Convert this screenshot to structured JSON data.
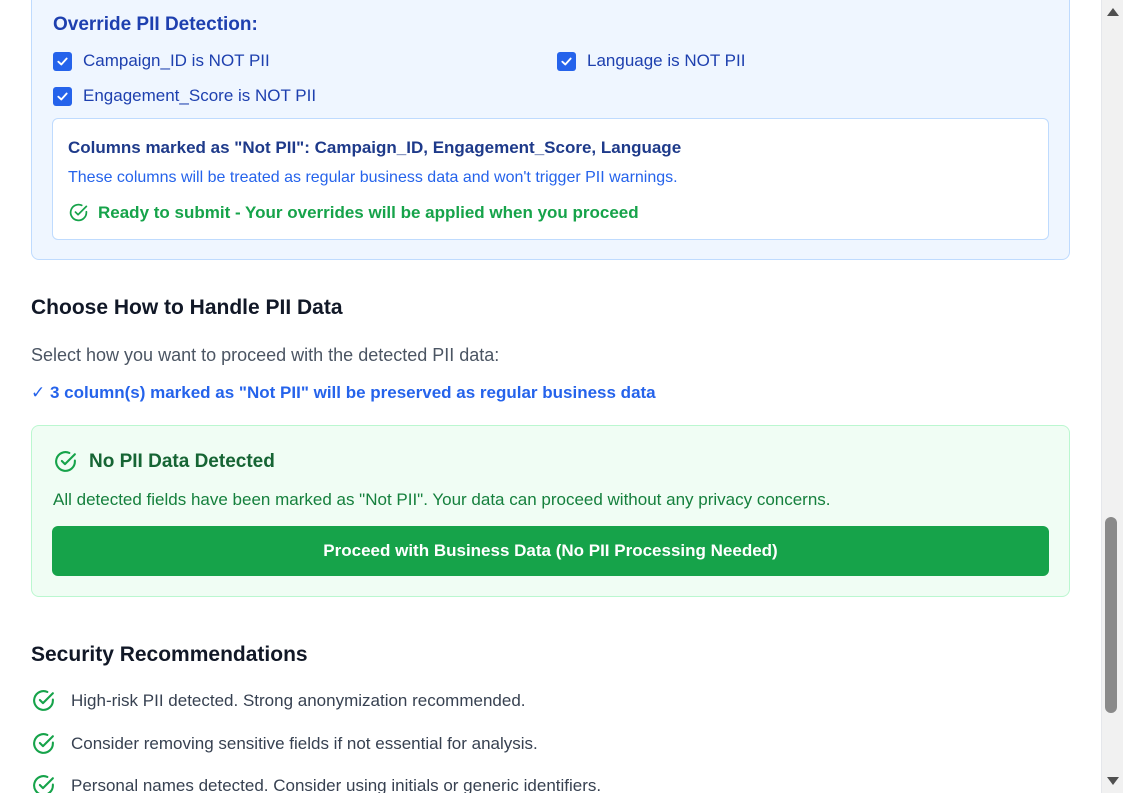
{
  "override": {
    "title": "Override PII Detection:",
    "checkboxes": [
      {
        "label": "Campaign_ID is NOT PII",
        "checked": true
      },
      {
        "label": "Language is NOT PII",
        "checked": true
      },
      {
        "label": "Engagement_Score is NOT PII",
        "checked": true
      }
    ],
    "summary": {
      "title": "Columns marked as \"Not PII\": Campaign_ID, Engagement_Score, Language",
      "description": "These columns will be treated as regular business data and won't trigger PII warnings.",
      "ready": "Ready to submit - Your overrides will be applied when you proceed"
    }
  },
  "choose": {
    "title": "Choose How to Handle PII Data",
    "subtitle": "Select how you want to proceed with the detected PII data:",
    "note": "✓ 3 column(s) marked as \"Not PII\" will be preserved as regular business data"
  },
  "no_pii": {
    "title": "No PII Data Detected",
    "description": "All detected fields have been marked as \"Not PII\". Your data can proceed without any privacy concerns.",
    "button_label": "Proceed with Business Data (No PII Processing Needed)"
  },
  "security": {
    "title": "Security Recommendations",
    "items": [
      "High-risk PII detected. Strong anonymization recommended.",
      "Consider removing sensitive fields if not essential for analysis.",
      "Personal names detected. Consider using initials or generic identifiers."
    ]
  },
  "colors": {
    "blue_accent": "#2563eb",
    "green_accent": "#16a34a",
    "panel_blue": "#eff6ff",
    "panel_green": "#f0fdf4"
  },
  "icons": {
    "checkbox": "check-icon",
    "ready": "check-circle-icon",
    "no_pii": "check-circle-icon",
    "recommendation": "check-circle-icon"
  }
}
